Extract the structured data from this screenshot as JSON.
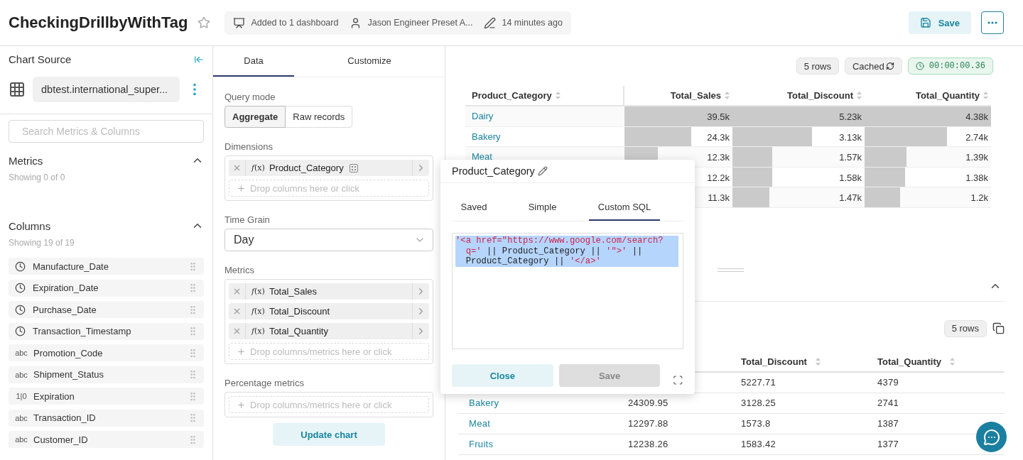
{
  "header": {
    "title": "CheckingDrillbyWithTag",
    "starred": false,
    "meta": [
      {
        "kind": "dashboard",
        "text": "Added to 1 dashboard"
      },
      {
        "kind": "owner",
        "text": "Jason Engineer Preset A..."
      },
      {
        "kind": "modified",
        "text": "14 minutes ago"
      }
    ],
    "save_label": "Save"
  },
  "source_panel": {
    "title": "Chart Source",
    "dataset": "dbtest.international_super...",
    "search": {
      "placeholder": "Search Metrics & Columns"
    },
    "sections": [
      {
        "title": "Metrics",
        "expanded": true,
        "count": "Showing 0 of 0"
      },
      {
        "title": "Columns",
        "expanded": true,
        "count": "Showing 19 of 19",
        "items": [
          {
            "kind": "time",
            "name": "Manufacture_Date"
          },
          {
            "kind": "time",
            "name": "Expiration_Date"
          },
          {
            "kind": "time",
            "name": "Purchase_Date"
          },
          {
            "kind": "time",
            "name": "Transaction_Timestamp"
          },
          {
            "kind": "string",
            "type_label": "abc",
            "name": "Promotion_Code"
          },
          {
            "kind": "string",
            "type_label": "abc",
            "name": "Shipment_Status"
          },
          {
            "kind": "number",
            "type_label": "1|0",
            "name": "Expiration"
          },
          {
            "kind": "string",
            "type_label": "abc",
            "name": "Transaction_ID"
          },
          {
            "kind": "string",
            "type_label": "abc",
            "name": "Customer_ID"
          }
        ]
      }
    ]
  },
  "config_panel": {
    "tabs": [
      {
        "label": "Data",
        "selected": true
      },
      {
        "label": "Customize",
        "selected": false
      }
    ],
    "query_mode": {
      "label": "Query mode",
      "options": [
        {
          "label": "Aggregate",
          "selected": true
        },
        {
          "label": "Raw records",
          "selected": false
        }
      ]
    },
    "fields": [
      {
        "kind": "list",
        "label": "Dimensions",
        "items": [
          {
            "expr": "*f*(x)",
            "name": "Product_Category",
            "tagged": true
          }
        ],
        "drop_hint": "Drop columns here or click"
      },
      {
        "kind": "select",
        "label": "Time Grain",
        "value": "Day"
      },
      {
        "kind": "list",
        "label": "Metrics",
        "items": [
          {
            "expr": "*f*(x)",
            "name": "Total_Sales",
            "tagged": false
          },
          {
            "expr": "*f*(x)",
            "name": "Total_Discount",
            "tagged": false
          },
          {
            "expr": "*f*(x)",
            "name": "Total_Quantity",
            "tagged": false
          }
        ],
        "drop_hint": "Drop columns/metrics here or click"
      },
      {
        "kind": "list",
        "label": "Percentage metrics",
        "drop_hint": "Drop columns/metrics here or click"
      }
    ],
    "update_label": "Update chart"
  },
  "chart": {
    "row_count": "5 rows",
    "cache": "Cached",
    "timer": "00:00:00.36",
    "columns": [
      "Product_Category",
      "Total_Sales",
      "Total_Discount",
      "Total_Quantity"
    ],
    "rows": [
      {
        "cells": [
          {
            "value": "Dairy"
          },
          {
            "value": "39.5k",
            "level": 1
          },
          {
            "value": "5.23k",
            "level": 1
          },
          {
            "value": "4.38k",
            "level": 1
          }
        ]
      },
      {
        "cells": [
          {
            "value": "Bakery"
          },
          {
            "value": "24.3k",
            "level": 0.62
          },
          {
            "value": "3.13k",
            "level": 0.6
          },
          {
            "value": "2.74k",
            "level": 0.65
          }
        ]
      },
      {
        "cells": [
          {
            "value": "Meat"
          },
          {
            "value": "12.3k",
            "level": 0.31
          },
          {
            "value": "1.57k",
            "level": 0.3
          },
          {
            "value": "1.39k",
            "level": 0.33
          }
        ]
      },
      {
        "cells": [
          {},
          {
            "value": "12.2k"
          },
          {
            "value": "1.58k",
            "level": 0.3
          },
          {
            "value": "1.38k",
            "level": 0.32
          }
        ]
      },
      {
        "cells": [
          {},
          {
            "value": "11.3k"
          },
          {
            "value": "1.47k",
            "level": 0.28
          },
          {
            "value": "1.2k",
            "level": 0.28
          }
        ]
      }
    ]
  },
  "samples": {
    "expanded": true,
    "row_count": "5 rows",
    "columns": [
      "",
      "",
      "Total_Discount",
      "Total_Quantity"
    ],
    "rows": [
      {
        "cells": [
          "",
          "",
          "5227.71",
          "4379"
        ]
      },
      {
        "cells": [
          "Bakery",
          "24309.95",
          "3128.25",
          "2741"
        ]
      },
      {
        "cells": [
          "Meat",
          "12297.88",
          "1573.8",
          "1387"
        ]
      },
      {
        "cells": [
          "Fruits",
          "12238.26",
          "1583.42",
          "1377"
        ]
      }
    ]
  },
  "popover": {
    "title": "Product_Category",
    "tabs": [
      {
        "label": "Saved",
        "selected": false
      },
      {
        "label": "Simple",
        "selected": false
      },
      {
        "label": "Custom SQL",
        "selected": true
      }
    ],
    "sql": [
      {
        "kind": "string",
        "text": "'<a href=\"https://www.google.com/search?q='"
      },
      {
        "kind": "plain",
        "text": " || Product_Category || "
      },
      {
        "kind": "string",
        "text": "'\">'"
      },
      {
        "kind": "plain",
        "text": " || Product_Category || "
      },
      {
        "kind": "string",
        "text": "'</a>'"
      }
    ],
    "sql_selected": true,
    "close_label": "Close",
    "save_label": "Save",
    "save_disabled": true
  }
}
